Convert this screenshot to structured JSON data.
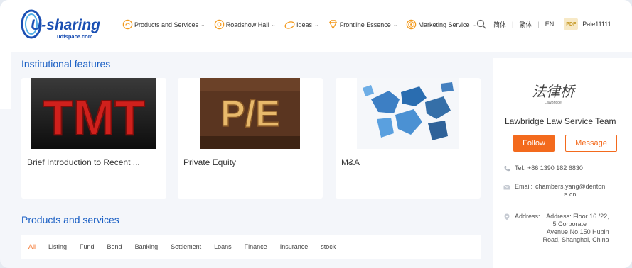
{
  "header": {
    "logo_text": "U-sharing",
    "logo_sub": "udfspace.com",
    "nav": [
      {
        "label": "Products and Services",
        "icon": "products-icon"
      },
      {
        "label": "Roadshow Hall",
        "icon": "roadshow-icon"
      },
      {
        "label": "Ideas",
        "icon": "ideas-icon"
      },
      {
        "label": "Frontline Essence",
        "icon": "frontline-icon"
      },
      {
        "label": "Marketing Service",
        "icon": "marketing-icon"
      }
    ],
    "chevron": "⌄",
    "lang_simplified": "简体",
    "lang_traditional": "繁体",
    "lang_en": "EN",
    "separator": "|",
    "badge": "PDF",
    "user": "Pale11111"
  },
  "institutional": {
    "title": "Institutional features",
    "cards": [
      {
        "caption": "Brief Introduction to Recent ...",
        "thumb_text": "TMT"
      },
      {
        "caption": "Private Equity",
        "thumb_text": "P/E"
      },
      {
        "caption": "M&A"
      }
    ]
  },
  "products": {
    "title": "Products and services",
    "tabs": [
      "All",
      "Listing",
      "Fund",
      "Bond",
      "Banking",
      "Settlement",
      "Loans",
      "Finance",
      "Insurance",
      "stock"
    ],
    "active_tab": "All"
  },
  "panel": {
    "logo_text": "法律桥",
    "logo_sub": "LawBridge",
    "org_name": "Lawbridge Law Service Team",
    "follow_label": "Follow",
    "message_label": "Message",
    "tel_label": "Tel:",
    "tel_value": "+86 1390 182 6830",
    "email_label": "Email:",
    "email_value_1": "chambers.yang@denton",
    "email_value_2": "s.cn",
    "address_label": "Address:",
    "address_lines": [
      "Address: Floor 16 /22,",
      "5 Corporate",
      "Avenue,No.150 Hubin",
      "Road, Shanghai, China"
    ]
  },
  "colors": {
    "accent": "#f36a1d",
    "link_blue": "#1a5fc4",
    "brand_blue": "#1a4fb3"
  }
}
